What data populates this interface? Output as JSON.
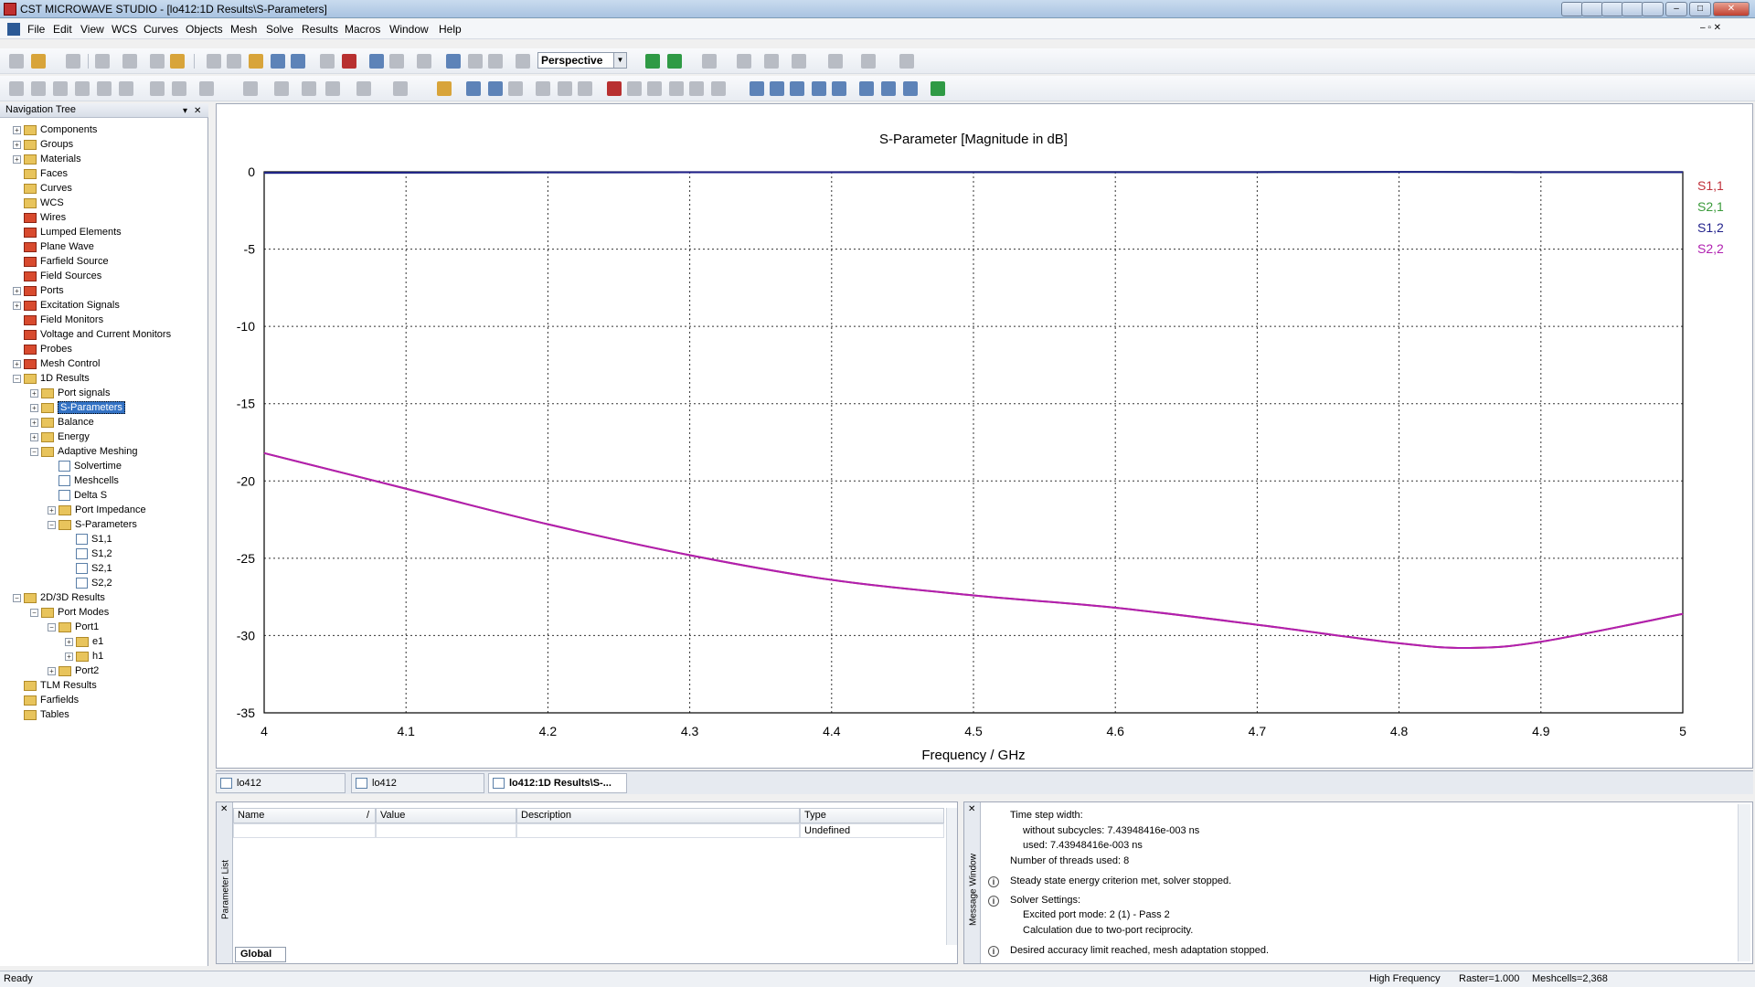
{
  "window": {
    "title": "CST MICROWAVE STUDIO - [lo412:1D Results\\S-Parameters]"
  },
  "menu": [
    "File",
    "Edit",
    "View",
    "WCS",
    "Curves",
    "Objects",
    "Mesh",
    "Solve",
    "Results",
    "Macros",
    "Window",
    "Help"
  ],
  "toolbar": {
    "view_mode": "Perspective"
  },
  "nav_tree": {
    "title": "Navigation Tree",
    "items": [
      {
        "label": "Components",
        "level": 0,
        "exp": "+",
        "icon": "folder"
      },
      {
        "label": "Groups",
        "level": 0,
        "exp": "+",
        "icon": "folder"
      },
      {
        "label": "Materials",
        "level": 0,
        "exp": "+",
        "icon": "folder"
      },
      {
        "label": "Faces",
        "level": 0,
        "exp": "",
        "icon": "folder"
      },
      {
        "label": "Curves",
        "level": 0,
        "exp": "",
        "icon": "folder"
      },
      {
        "label": "WCS",
        "level": 0,
        "exp": "",
        "icon": "folder"
      },
      {
        "label": "Wires",
        "level": 0,
        "exp": "",
        "icon": "red"
      },
      {
        "label": "Lumped Elements",
        "level": 0,
        "exp": "",
        "icon": "red"
      },
      {
        "label": "Plane Wave",
        "level": 0,
        "exp": "",
        "icon": "red"
      },
      {
        "label": "Farfield Source",
        "level": 0,
        "exp": "",
        "icon": "red"
      },
      {
        "label": "Field Sources",
        "level": 0,
        "exp": "",
        "icon": "red"
      },
      {
        "label": "Ports",
        "level": 0,
        "exp": "+",
        "icon": "red"
      },
      {
        "label": "Excitation Signals",
        "level": 0,
        "exp": "+",
        "icon": "red"
      },
      {
        "label": "Field Monitors",
        "level": 0,
        "exp": "",
        "icon": "red"
      },
      {
        "label": "Voltage and Current Monitors",
        "level": 0,
        "exp": "",
        "icon": "red"
      },
      {
        "label": "Probes",
        "level": 0,
        "exp": "",
        "icon": "red"
      },
      {
        "label": "Mesh Control",
        "level": 0,
        "exp": "+",
        "icon": "red"
      },
      {
        "label": "1D Results",
        "level": 0,
        "exp": "-",
        "icon": "folder"
      },
      {
        "label": "Port signals",
        "level": 1,
        "exp": "+",
        "icon": "folder"
      },
      {
        "label": "S-Parameters",
        "level": 1,
        "exp": "+",
        "icon": "folder",
        "selected": true
      },
      {
        "label": "Balance",
        "level": 1,
        "exp": "+",
        "icon": "folder"
      },
      {
        "label": "Energy",
        "level": 1,
        "exp": "+",
        "icon": "folder"
      },
      {
        "label": "Adaptive Meshing",
        "level": 1,
        "exp": "-",
        "icon": "folder"
      },
      {
        "label": "Solvertime",
        "level": 2,
        "exp": "",
        "icon": "result"
      },
      {
        "label": "Meshcells",
        "level": 2,
        "exp": "",
        "icon": "result"
      },
      {
        "label": "Delta S",
        "level": 2,
        "exp": "",
        "icon": "result"
      },
      {
        "label": "Port Impedance",
        "level": 2,
        "exp": "+",
        "icon": "folder"
      },
      {
        "label": "S-Parameters",
        "level": 2,
        "exp": "-",
        "icon": "folder"
      },
      {
        "label": "S1,1",
        "level": 3,
        "exp": "",
        "icon": "result"
      },
      {
        "label": "S1,2",
        "level": 3,
        "exp": "",
        "icon": "result"
      },
      {
        "label": "S2,1",
        "level": 3,
        "exp": "",
        "icon": "result"
      },
      {
        "label": "S2,2",
        "level": 3,
        "exp": "",
        "icon": "result"
      },
      {
        "label": "2D/3D Results",
        "level": 0,
        "exp": "-",
        "icon": "folder"
      },
      {
        "label": "Port Modes",
        "level": 1,
        "exp": "-",
        "icon": "folder"
      },
      {
        "label": "Port1",
        "level": 2,
        "exp": "-",
        "icon": "folder"
      },
      {
        "label": "e1",
        "level": 3,
        "exp": "+",
        "icon": "folder"
      },
      {
        "label": "h1",
        "level": 3,
        "exp": "+",
        "icon": "folder"
      },
      {
        "label": "Port2",
        "level": 2,
        "exp": "+",
        "icon": "folder"
      },
      {
        "label": "TLM Results",
        "level": 0,
        "exp": "",
        "icon": "folder"
      },
      {
        "label": "Farfields",
        "level": 0,
        "exp": "",
        "icon": "folder"
      },
      {
        "label": "Tables",
        "level": 0,
        "exp": "",
        "icon": "folder"
      }
    ]
  },
  "chart_data": {
    "type": "line",
    "title": "S-Parameter [Magnitude in dB]",
    "xlabel": "Frequency / GHz",
    "ylabel": "",
    "xlim": [
      4,
      5
    ],
    "ylim": [
      -35,
      0
    ],
    "xticks": [
      "4",
      "4.1",
      "4.2",
      "4.3",
      "4.4",
      "4.5",
      "4.6",
      "4.7",
      "4.8",
      "4.9",
      "5"
    ],
    "yticks": [
      "0",
      "-5",
      "-10",
      "-15",
      "-20",
      "-25",
      "-30",
      "-35"
    ],
    "grid": true,
    "legend_position": "right",
    "series": [
      {
        "name": "S1,1",
        "color": "#c0303a",
        "x": [
          4.0,
          4.1,
          4.2,
          4.3,
          4.4,
          4.5,
          4.6,
          4.7,
          4.8,
          4.85,
          4.9,
          5.0
        ],
        "y": [
          -18.2,
          -20.5,
          -22.8,
          -24.8,
          -26.4,
          -27.4,
          -28.2,
          -29.3,
          -30.5,
          -30.8,
          -30.4,
          -28.6
        ]
      },
      {
        "name": "S2,1",
        "color": "#3a9a3a",
        "x": [
          4.0,
          4.1,
          4.2,
          4.3,
          4.4,
          4.5,
          4.6,
          4.7,
          4.8,
          4.9,
          5.0
        ],
        "y": [
          -0.07,
          -0.05,
          -0.04,
          -0.03,
          -0.03,
          -0.02,
          -0.02,
          -0.02,
          -0.01,
          -0.02,
          -0.02
        ]
      },
      {
        "name": "S1,2",
        "color": "#1f1f8a",
        "x": [
          4.0,
          4.1,
          4.2,
          4.3,
          4.4,
          4.5,
          4.6,
          4.7,
          4.8,
          4.9,
          5.0
        ],
        "y": [
          -0.07,
          -0.05,
          -0.04,
          -0.03,
          -0.03,
          -0.02,
          -0.02,
          -0.02,
          -0.01,
          -0.02,
          -0.02
        ]
      },
      {
        "name": "S2,2",
        "color": "#b020b0",
        "x": [
          4.0,
          4.1,
          4.2,
          4.3,
          4.4,
          4.5,
          4.6,
          4.7,
          4.8,
          4.85,
          4.9,
          5.0
        ],
        "y": [
          -18.2,
          -20.5,
          -22.8,
          -24.8,
          -26.4,
          -27.4,
          -28.2,
          -29.3,
          -30.5,
          -30.8,
          -30.4,
          -28.6
        ]
      }
    ]
  },
  "tabs": [
    {
      "label": "lo412",
      "active": false
    },
    {
      "label": "lo412",
      "active": false
    },
    {
      "label": "lo412:1D Results\\S-...",
      "active": true
    }
  ],
  "param_list": {
    "title": "Parameter List",
    "columns": [
      "Name",
      "/",
      "Value",
      "Description",
      "Type"
    ],
    "row": {
      "type": "Undefined"
    },
    "tab": "Global"
  },
  "message_window": {
    "title": "Message Window",
    "lines": [
      {
        "text": "Time step width:",
        "indent": 0,
        "icon": false
      },
      {
        "text": "without subcycles: 7.43948416e-003 ns",
        "indent": 1,
        "icon": false
      },
      {
        "text": "used: 7.43948416e-003 ns",
        "indent": 1,
        "icon": false
      },
      {
        "text": "Number of threads used: 8",
        "indent": 0,
        "icon": false
      },
      {
        "text": "Steady state energy criterion met, solver stopped.",
        "indent": 0,
        "icon": true
      },
      {
        "text": "Solver Settings:",
        "indent": 0,
        "icon": true
      },
      {
        "text": "Excited port mode: 2 (1) - Pass 2",
        "indent": 1,
        "icon": false
      },
      {
        "text": "Calculation due to two-port reciprocity.",
        "indent": 1,
        "icon": false
      },
      {
        "text": "Desired accuracy limit reached, mesh adaptation stopped.",
        "indent": 0,
        "icon": true
      }
    ]
  },
  "status": {
    "left": "Ready",
    "mode": "High Frequency",
    "raster": "Raster=1.000",
    "meshcells": "Meshcells=2,368"
  }
}
